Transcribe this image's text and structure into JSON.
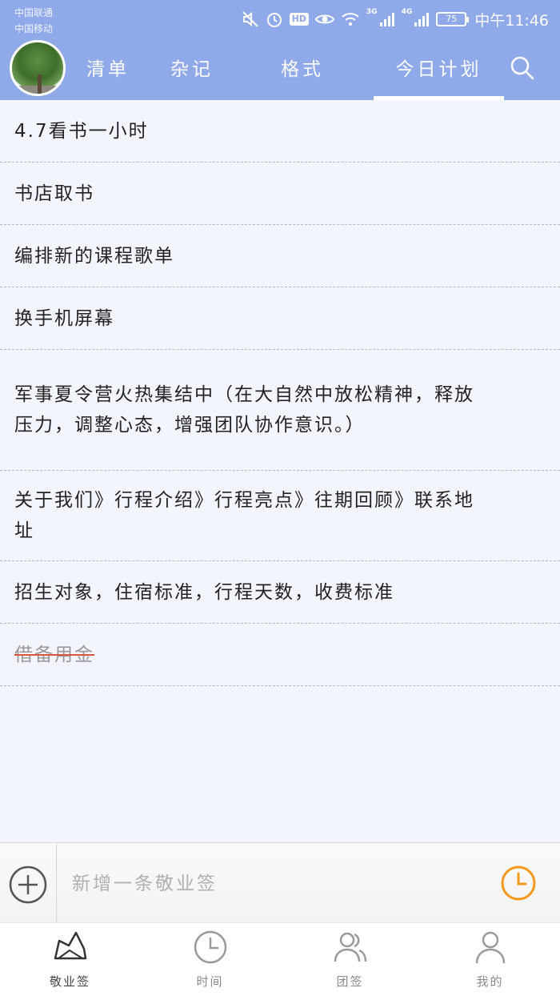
{
  "status_bar": {
    "carrier_1": "中国联通",
    "carrier_2": "中国移动",
    "hd_badge": "HD",
    "net_1": "3G",
    "net_2": "4G",
    "battery": "75",
    "time": "中午11:46"
  },
  "header": {
    "tabs": [
      {
        "label": "清单"
      },
      {
        "label": "杂记"
      },
      {
        "label": "格式"
      },
      {
        "label": "今日计划"
      }
    ],
    "active_tab": "今日计划"
  },
  "list": {
    "items": [
      {
        "text": "4.7看书一小时",
        "done": false
      },
      {
        "text": "书店取书",
        "done": false
      },
      {
        "text": "编排新的课程歌单",
        "done": false
      },
      {
        "text": "换手机屏幕",
        "done": false
      },
      {
        "text": "军事夏令营火热集结中（在大自然中放松精神，释放压力，调整心态，增强团队协作意识。）",
        "done": false
      },
      {
        "text": "关于我们》行程介绍》行程亮点》往期回顾》联系地址",
        "done": false
      },
      {
        "text": "招生对象，住宿标准，行程天数，收费标准",
        "done": false
      },
      {
        "text": "借备用金",
        "done": true
      }
    ]
  },
  "input_bar": {
    "placeholder": "新增一条敬业签",
    "value": ""
  },
  "bottom_nav": {
    "items": [
      {
        "label": "敬业签",
        "icon": "note-icon",
        "active": true
      },
      {
        "label": "时间",
        "icon": "clock-icon",
        "active": false
      },
      {
        "label": "团签",
        "icon": "team-icon",
        "active": false
      },
      {
        "label": "我的",
        "icon": "profile-icon",
        "active": false
      }
    ]
  },
  "colors": {
    "header_bg": "#8fa9e9",
    "list_bg": "#f2f5fd",
    "clock_accent": "#f39a1d",
    "strike": "#e0553a"
  }
}
